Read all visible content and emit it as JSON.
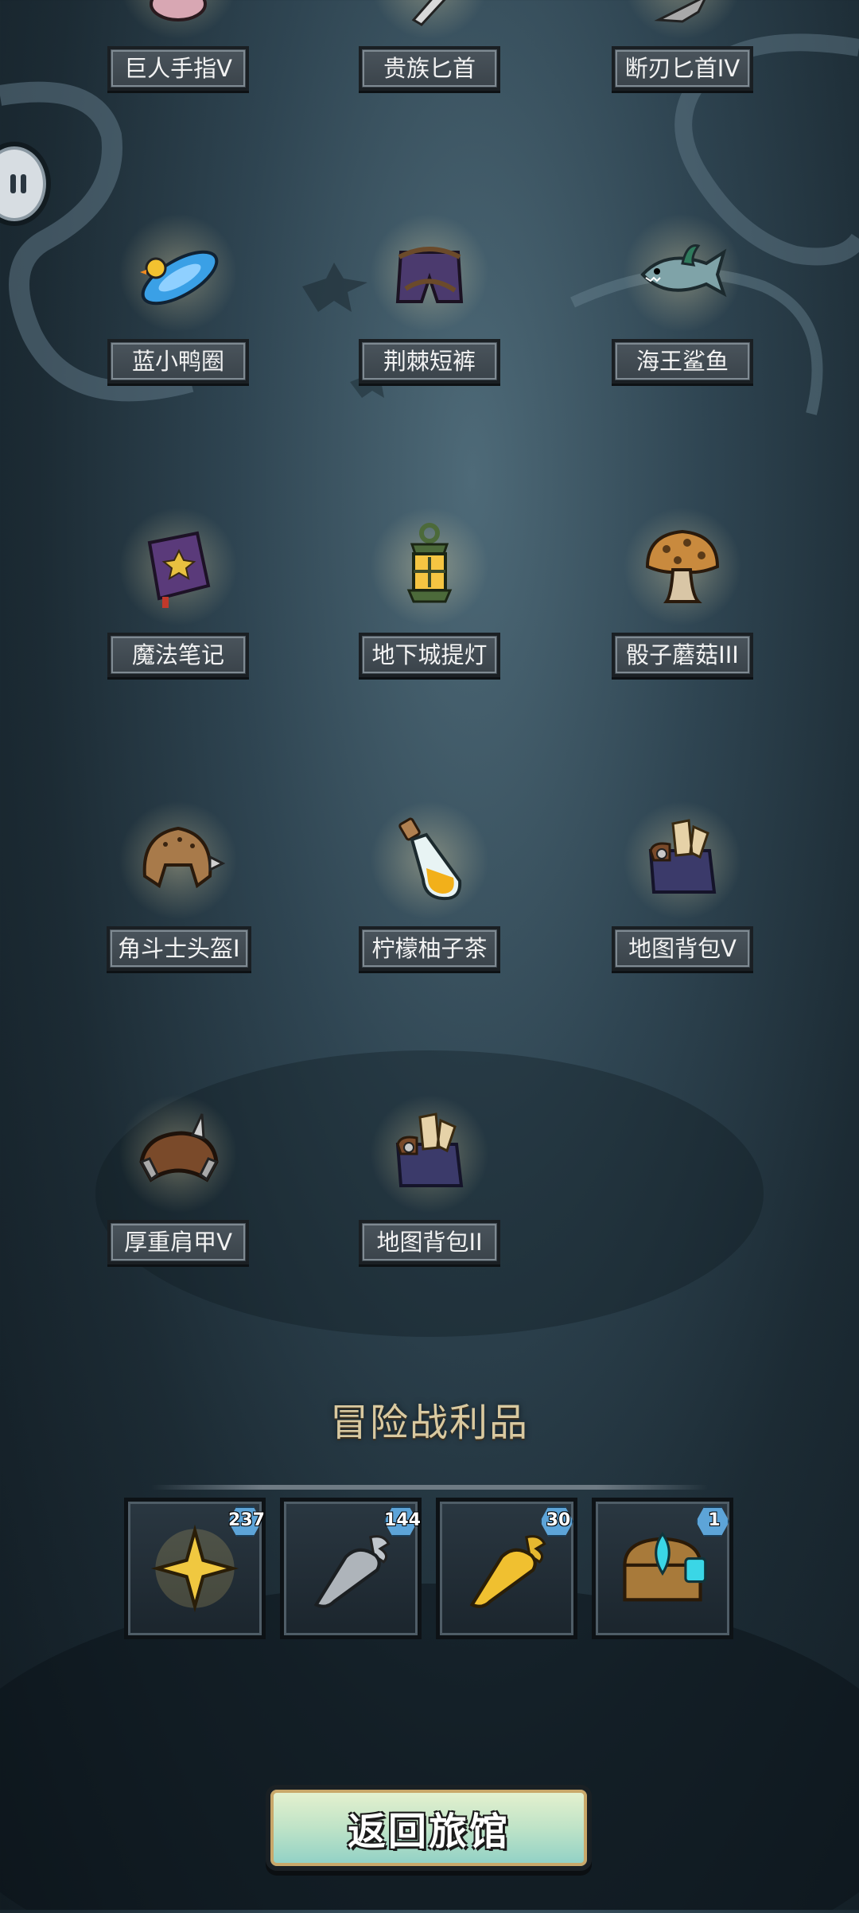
{
  "equipment_items": [
    {
      "name": "巨人手指V",
      "icon": "giant-finger-icon"
    },
    {
      "name": "贵族匕首",
      "icon": "noble-dagger-icon"
    },
    {
      "name": "断刃匕首IV",
      "icon": "broken-dagger-icon"
    },
    {
      "name": "蓝小鸭圈",
      "icon": "duck-float-icon"
    },
    {
      "name": "荆棘短裤",
      "icon": "thorn-shorts-icon"
    },
    {
      "name": "海王鲨鱼",
      "icon": "shark-icon"
    },
    {
      "name": "魔法笔记",
      "icon": "magic-book-icon"
    },
    {
      "name": "地下城提灯",
      "icon": "lantern-icon"
    },
    {
      "name": "骰子蘑菇III",
      "icon": "dice-mushroom-icon"
    },
    {
      "name": "角斗士头盔I",
      "icon": "gladiator-helmet-icon"
    },
    {
      "name": "柠檬柚子茶",
      "icon": "potion-icon"
    },
    {
      "name": "地图背包V",
      "icon": "map-backpack-icon"
    },
    {
      "name": "厚重肩甲V",
      "icon": "pauldron-icon"
    },
    {
      "name": "地图背包II",
      "icon": "map-backpack-icon"
    }
  ],
  "loot": {
    "title": "冒险战利品",
    "items": [
      {
        "icon": "gold-star-icon",
        "count": "237"
      },
      {
        "icon": "silver-carrot-icon",
        "count": "144"
      },
      {
        "icon": "gold-carrot-icon",
        "count": "30"
      },
      {
        "icon": "treasure-chest-icon",
        "count": "1"
      }
    ]
  },
  "return_button": "返回旅馆",
  "colors": {
    "label_bg": "#3f484f",
    "title_gold": "#d9c9a0",
    "badge_blue": "#5da4d8",
    "button_mint": "#bfe3c7"
  }
}
